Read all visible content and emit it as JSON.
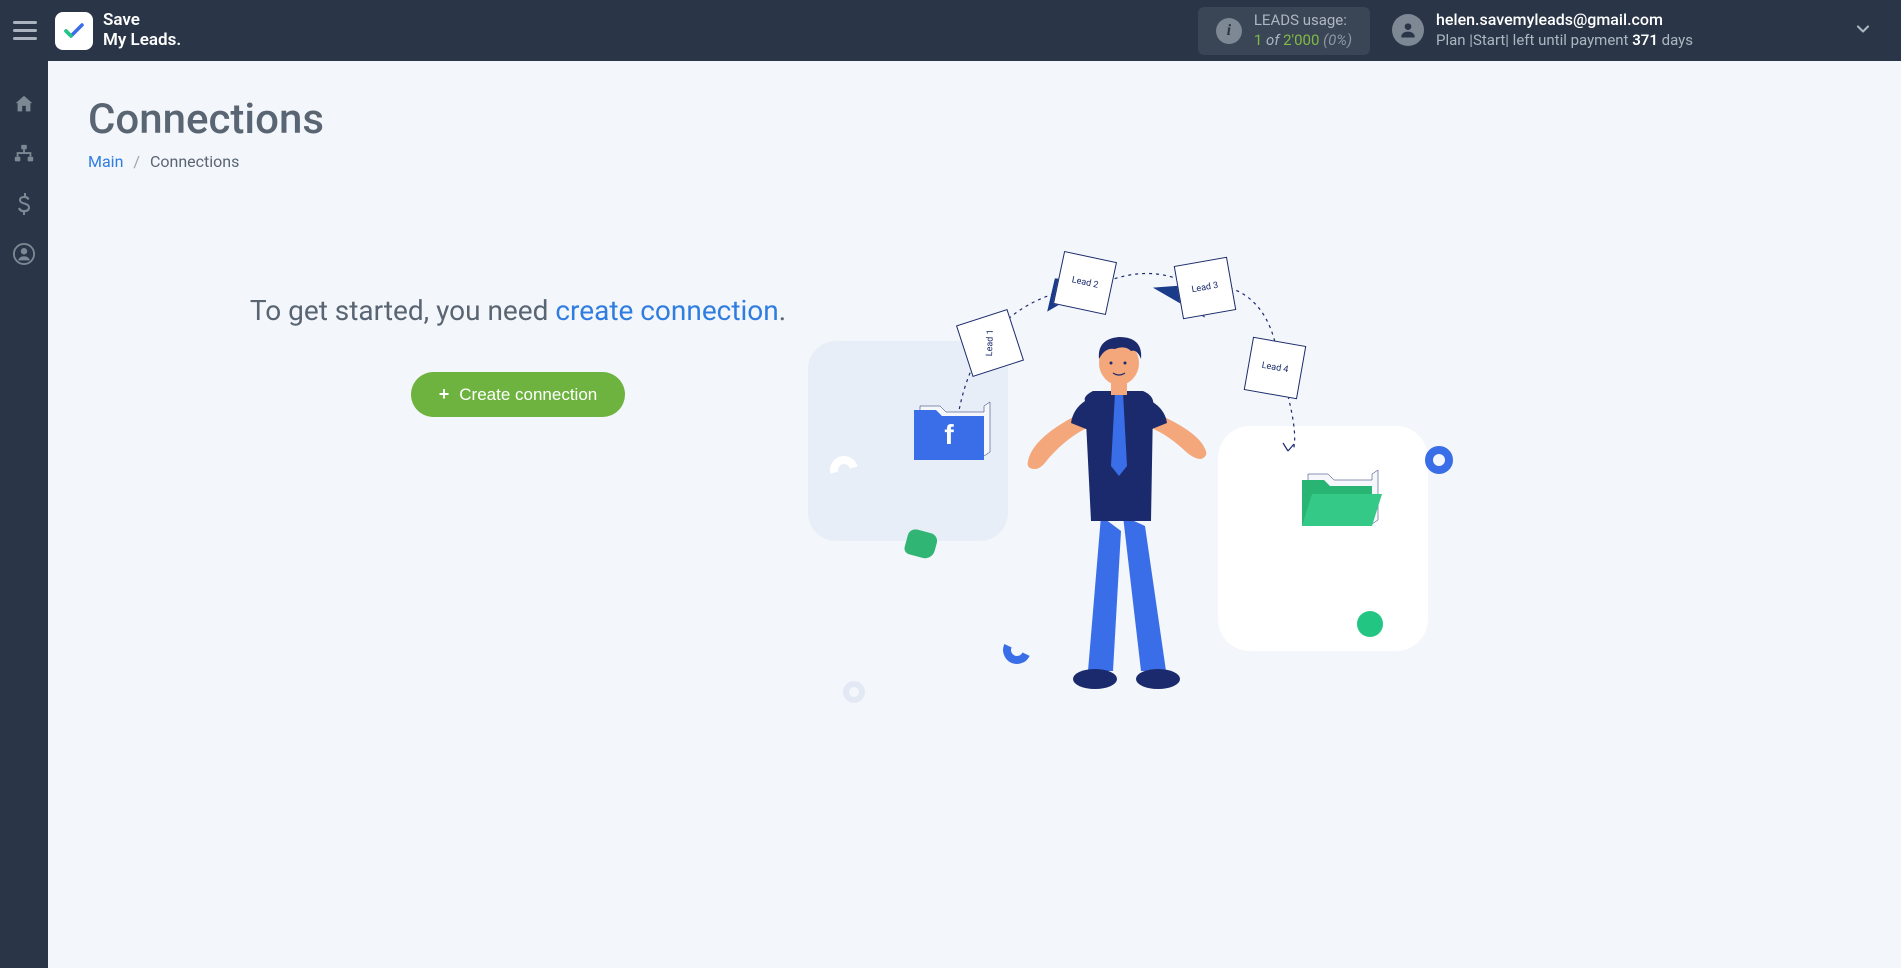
{
  "header": {
    "logo_line1": "Save",
    "logo_line2": "My Leads.",
    "leads": {
      "label": "LEADS usage:",
      "used": "1",
      "of": "of",
      "total": "2'000",
      "pct": "(0%)"
    },
    "account": {
      "email": "helen.savemyleads@gmail.com",
      "plan_prefix": "Plan |Start| left until payment ",
      "days": "371",
      "days_suffix": " days"
    }
  },
  "page": {
    "title": "Connections",
    "breadcrumb_main": "Main",
    "breadcrumb_current": "Connections"
  },
  "cta": {
    "text_prefix": "To get started, you need ",
    "link_text": "create connection",
    "text_suffix": ".",
    "button": "Create connection"
  },
  "illustration": {
    "lead1": "Lead 1",
    "lead2": "Lead 2",
    "lead3": "Lead 3",
    "lead4": "Lead 4"
  }
}
